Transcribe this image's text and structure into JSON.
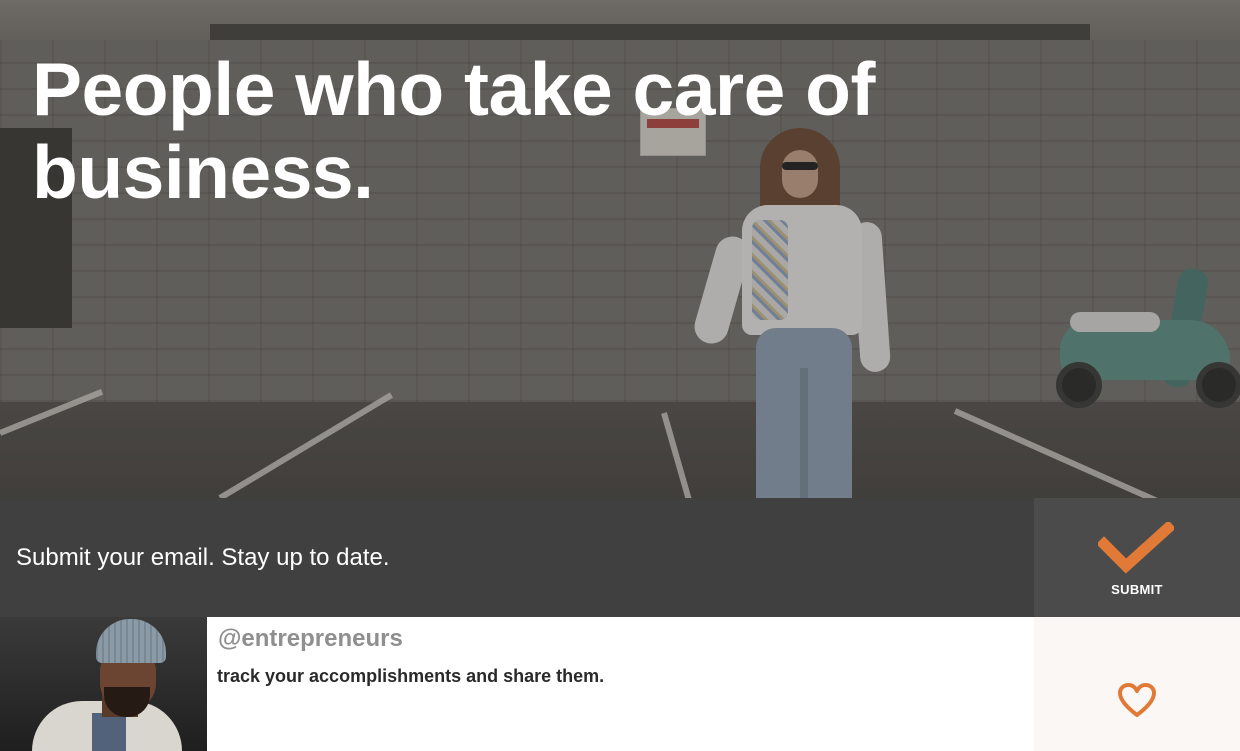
{
  "hero": {
    "title": "People who take care of business."
  },
  "email_signup": {
    "placeholder": "Submit your email. Stay up to date.",
    "submit_label": "SUBMIT"
  },
  "post": {
    "handle": "@entrepreneurs",
    "text": "track your accomplishments and share them."
  },
  "colors": {
    "accent": "#E07A36",
    "email_bar_bg": "#404040",
    "submit_bg": "#4B4B4B",
    "like_panel_bg": "#FAF7F5"
  },
  "icons": {
    "submit": "checkmark-icon",
    "like": "heart-icon"
  }
}
